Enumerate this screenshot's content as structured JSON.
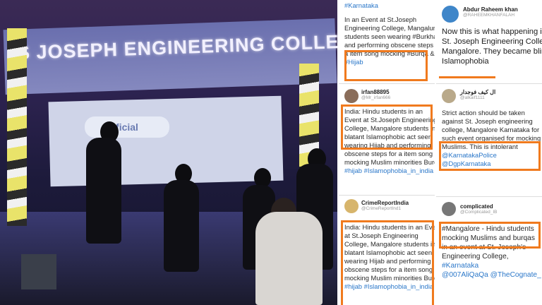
{
  "photo": {
    "banner_text": "S JOSEPH ENGINEERING COLLEGE",
    "screen_logo": "ficial"
  },
  "col1": {
    "t0": {
      "lines": [
        "#Karnataka",
        "",
        "In an Event at St.Joseph",
        "Engineering College, Mangaluru",
        "students seen wearing #Burkha",
        "and performing obscene steps for",
        "a item song mocking #Burqa &",
        "#Hijab"
      ]
    },
    "t1": {
      "user": "irfan88895",
      "handle": "@Mr_irfan666",
      "lines": [
        "India: Hindu students in an",
        "Event at St.Joseph Engineering",
        "College, Mangalore students in",
        "blatant Islamophobic act seen",
        "wearing Hijab and performing",
        "obscene steps for a item song",
        "mocking Muslim minorities Burqa",
        "#hijab #Islamophobia_in_india"
      ]
    },
    "t2": {
      "user": "CrimeReportIndia",
      "handle": "@CrimeReportInd1",
      "lines": [
        "India: Hindu students in an Event",
        "at St.Joseph Engineering",
        "College, Mangalore students in",
        "blatant Islamophobic act seen",
        "wearing Hijab and performing",
        "obscene steps for a item song",
        "mocking Muslim minorities Burqa",
        "#hijab #Islamophobia_in_india"
      ]
    }
  },
  "col2": {
    "t0": {
      "user": "Abdur Raheem khan",
      "handle": "@RAHEEMKHANFALAH",
      "lines": [
        "Now this is what happening in",
        "St. Joseph Engineering College,",
        "Mangalore. They became blind in",
        "Islamophobia"
      ]
    },
    "t1": {
      "user": "ال كيف فوجدار",
      "handle": "@alkaif1111",
      "lines": [
        "Strict action should be taken",
        "against St. Joseph engineering",
        "college, Mangalore Karnataka for",
        "such event organised for mocking",
        "Muslims. This is intolerant",
        "@KarnatakaPolice",
        "@DgpKarnataka"
      ]
    },
    "t2": {
      "user": "complicated",
      "handle": "@Complicated_IB",
      "lines": [
        "#Mangalore - Hindu students",
        "mocking Muslims and burqas",
        "in an event at St. Joseph's",
        "Engineering College,",
        "#Karnataka",
        "@007AliQaQa @TheCognate_"
      ]
    }
  },
  "colors": {
    "highlight_box": "#f07a1e",
    "link": "#2a77c9"
  }
}
